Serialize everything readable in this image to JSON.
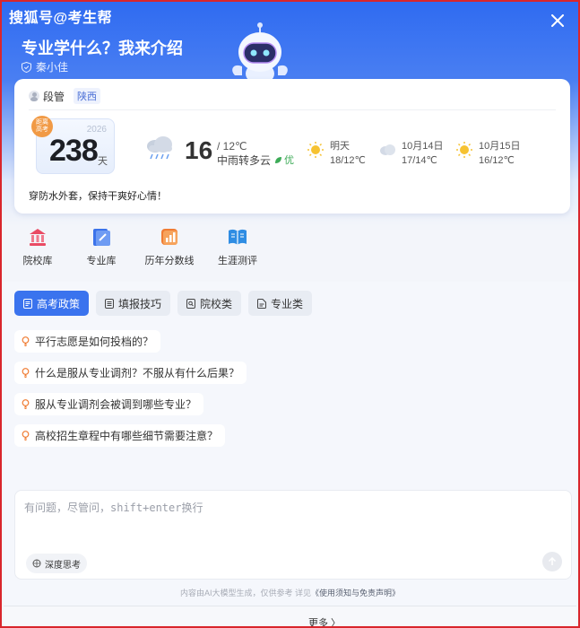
{
  "watermark": "搜狐号@考生帮",
  "header": {
    "title": "专业学什么？我来介绍",
    "author": "秦小佳"
  },
  "card": {
    "user_name": "段管",
    "region": "陕西",
    "countdown": {
      "badge_line1": "距离",
      "badge_line2": "高考",
      "year": "2026",
      "days": "238",
      "unit": "天"
    },
    "weather": {
      "temp": "16",
      "low": "/ 12℃",
      "desc": "中雨转多云",
      "air_quality": "优",
      "forecast": [
        {
          "day": "明天",
          "range": "18/12℃",
          "icon": "sun-icon"
        },
        {
          "day": "10月14日",
          "range": "17/14℃",
          "icon": "cloud-icon"
        },
        {
          "day": "10月15日",
          "range": "16/12℃",
          "icon": "sun-icon"
        }
      ]
    },
    "tip": "穿防水外套，保持干爽好心情！"
  },
  "tools": [
    {
      "label": "院校库",
      "icon": "college-icon",
      "color": "#e94b64"
    },
    {
      "label": "专业库",
      "icon": "major-icon",
      "color": "#3c73ea"
    },
    {
      "label": "历年分数线",
      "icon": "score-line-icon",
      "color": "#f07c33"
    },
    {
      "label": "生涯测评",
      "icon": "career-icon",
      "color": "#2f8de3"
    }
  ],
  "tabs": [
    {
      "label": "高考政策",
      "active": true
    },
    {
      "label": "填报技巧",
      "active": false
    },
    {
      "label": "院校类",
      "active": false
    },
    {
      "label": "专业类",
      "active": false
    }
  ],
  "questions": [
    "平行志愿是如何投档的？",
    "什么是服从专业调剂？不服从有什么后果？",
    "服从专业调剂会被调到哪些专业？",
    "高校招生章程中有哪些细节需要注意？"
  ],
  "input": {
    "placeholder": "有问题，尽管问，shift+enter换行",
    "deep_think": "深度思考"
  },
  "footer": {
    "disclaimer": "内容由AI大模型生成，仅供参考 详见",
    "link": "《使用须知与免责声明》",
    "more": "更多 〉"
  },
  "colors": {
    "brand_blue": "#2f6bf1",
    "active_tab": "#3a73ee",
    "good_air": "#3cab57"
  }
}
